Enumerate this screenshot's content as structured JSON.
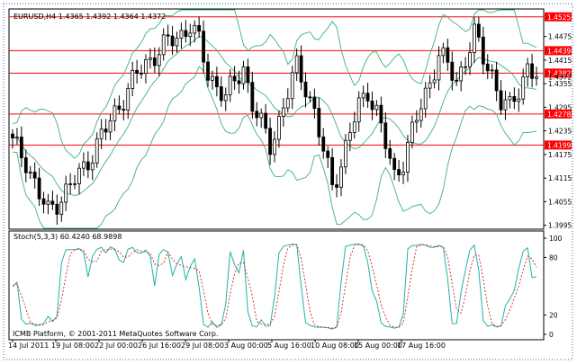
{
  "chart_data": {
    "type": "candlestick",
    "symbol_header": "EURUSD,H4  1.4365 1.4392 1.4364 1.4372",
    "price_axis": {
      "ticks": [
        1.4475,
        1.4415,
        1.4355,
        1.4295,
        1.4235,
        1.4175,
        1.4115,
        1.4055,
        1.3995
      ],
      "range": [
        1.3985,
        1.4545
      ]
    },
    "horizontal_levels": [
      "1.4525",
      "1.4439",
      "1.4382",
      "1.4278",
      "1.4199"
    ],
    "current_price": "1.4372",
    "time_axis": {
      "labels": [
        "14 Jul 2011",
        "19 Jul 08:00",
        "22 Jul 00:00",
        "26 Jul 16:00",
        "29 Jul 08:00",
        "3 Aug 00:00",
        "5 Aug 16:00",
        "10 Aug 08:00",
        "15 Aug 00:00",
        "17 Aug 16:00"
      ]
    },
    "price_keypoints": [
      [
        0,
        1.4205
      ],
      [
        3,
        1.416
      ],
      [
        6,
        1.407
      ],
      [
        8,
        1.403
      ],
      [
        12,
        1.408
      ],
      [
        16,
        1.414
      ],
      [
        20,
        1.422
      ],
      [
        24,
        1.43
      ],
      [
        28,
        1.438
      ],
      [
        32,
        1.443
      ],
      [
        35,
        1.446
      ],
      [
        38,
        1.448
      ],
      [
        40,
        1.4505
      ],
      [
        42,
        1.446
      ],
      [
        44,
        1.438
      ],
      [
        46,
        1.435
      ],
      [
        48,
        1.432
      ],
      [
        50,
        1.436
      ],
      [
        52,
        1.44
      ],
      [
        54,
        1.43
      ],
      [
        56,
        1.425
      ],
      [
        58,
        1.42
      ],
      [
        60,
        1.426
      ],
      [
        62,
        1.433
      ],
      [
        64,
        1.44
      ],
      [
        66,
        1.435
      ],
      [
        68,
        1.428
      ],
      [
        70,
        1.418
      ],
      [
        72,
        1.41
      ],
      [
        74,
        1.415
      ],
      [
        76,
        1.423
      ],
      [
        78,
        1.43
      ],
      [
        80,
        1.434
      ],
      [
        82,
        1.428
      ],
      [
        84,
        1.42
      ],
      [
        86,
        1.412
      ],
      [
        88,
        1.416
      ],
      [
        90,
        1.423
      ],
      [
        92,
        1.43
      ],
      [
        94,
        1.436
      ],
      [
        96,
        1.443
      ],
      [
        98,
        1.44
      ],
      [
        100,
        1.436
      ],
      [
        102,
        1.442
      ],
      [
        104,
        1.448
      ],
      [
        106,
        1.442
      ],
      [
        108,
        1.438
      ],
      [
        110,
        1.431
      ],
      [
        112,
        1.429
      ],
      [
        114,
        1.434
      ],
      [
        116,
        1.44
      ],
      [
        118,
        1.4372
      ]
    ],
    "stochastic": {
      "header": "Stoch(5,3,3) 60.4240 68.9898",
      "ticks": [
        100,
        80,
        20,
        0
      ],
      "main_color": "#20b2aa",
      "signal_color": "#e03030"
    },
    "bands_color": "#3cb371",
    "level_color": "#ff0000"
  },
  "footer": {
    "copyright": "ICMB Platform, © 2001-2011 MetaQuotes Software Corp."
  }
}
